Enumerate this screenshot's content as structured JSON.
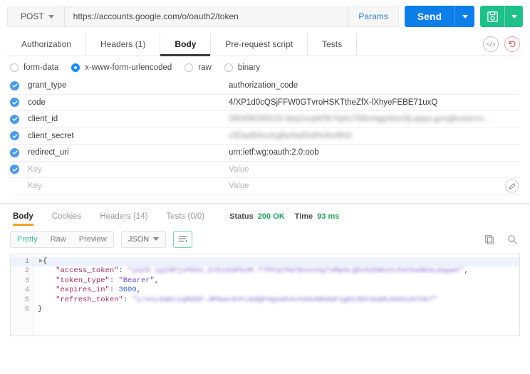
{
  "request": {
    "method": "POST",
    "url": "https://accounts.google.com/o/oauth2/token",
    "params_label": "Params",
    "send_label": "Send",
    "save_icon": "floppy-disk-icon",
    "code_icon": "code-brackets-icon",
    "reset_icon": "undo-reset-icon",
    "tabs": [
      {
        "label": "Authorization",
        "active": false
      },
      {
        "label": "Headers (1)",
        "active": false
      },
      {
        "label": "Body",
        "active": true
      },
      {
        "label": "Pre-request script",
        "active": false
      },
      {
        "label": "Tests",
        "active": false
      }
    ],
    "body_types": [
      {
        "label": "form-data",
        "checked": false
      },
      {
        "label": "x-www-form-urlencoded",
        "checked": true
      },
      {
        "label": "raw",
        "checked": false
      },
      {
        "label": "binary",
        "checked": false
      }
    ],
    "kv_placeholders": {
      "key": "Key",
      "value": "Value"
    },
    "kv_rows": [
      {
        "checked": true,
        "key": "grant_type",
        "value": "authorization_code",
        "blurred": false
      },
      {
        "checked": true,
        "key": "code",
        "value": "4/XP1d0cQSjFFW0GTvroHSKTtheZfX-lXhyeFEBE71uxQ",
        "blurred": false
      },
      {
        "checked": true,
        "key": "client_id",
        "value": "390486349115-bkq2uvpkf3b7iq4u7t5kmiqgnben5lj.apps.googleusercontent.com",
        "blurred": true
      },
      {
        "checked": true,
        "key": "client_secret",
        "value": "v3Dad94cuXgBw5wfGdHv8m8N3",
        "blurred": true
      },
      {
        "checked": true,
        "key": "redirect_uri",
        "value": "urn:ietf:wg:oauth:2.0:oob",
        "blurred": false
      },
      {
        "checked": true,
        "key": "Key",
        "value": "Value",
        "blurred": false,
        "placeholder": true
      },
      {
        "checked": false,
        "key": "Key",
        "value": "Value",
        "blurred": false,
        "placeholder": true
      }
    ],
    "bulk_edit_icon": "pencil-edit-icon"
  },
  "response": {
    "tabs": [
      {
        "label": "Body",
        "active": true
      },
      {
        "label": "Cookies",
        "active": false
      },
      {
        "label": "Headers (14)",
        "active": false
      },
      {
        "label": "Tests (0/0)",
        "active": false
      }
    ],
    "status_label": "Status",
    "status_value": "200 OK",
    "time_label": "Time",
    "time_value": "93 ms",
    "view_modes": [
      {
        "label": "Pretty",
        "active": true
      },
      {
        "label": "Raw",
        "active": false
      },
      {
        "label": "Preview",
        "active": false
      }
    ],
    "format_selected": "JSON",
    "wrap_icon": "wrap-lines-icon",
    "copy_icon": "copy-icon",
    "search_icon": "search-icon",
    "body_lines": [
      {
        "n": "1",
        "foldable": true,
        "highlight": true,
        "tokens": [
          {
            "t": "{",
            "c": "pun"
          }
        ]
      },
      {
        "n": "2",
        "foldable": false,
        "highlight": false,
        "tokens": [
          {
            "t": "    \"access_token\"",
            "c": "key"
          },
          {
            "t": ": ",
            "c": "pun"
          },
          {
            "t": "\"ya29.igIHPjsP89z_bYbi93PkeM.T7PFqtPm7BsXvVg7oMpOLQ6vhZDNuVLPeChaNKALDqqah\"",
            "c": "blur"
          },
          {
            "t": ",",
            "c": "pun"
          }
        ]
      },
      {
        "n": "3",
        "foldable": false,
        "highlight": false,
        "tokens": [
          {
            "t": "    \"token_type\"",
            "c": "key"
          },
          {
            "t": ": ",
            "c": "pun"
          },
          {
            "t": "\"Bearer\"",
            "c": "str"
          },
          {
            "t": ",",
            "c": "pun"
          }
        ]
      },
      {
        "n": "4",
        "foldable": false,
        "highlight": false,
        "tokens": [
          {
            "t": "    \"expires_in\"",
            "c": "key"
          },
          {
            "t": ": ",
            "c": "pun"
          },
          {
            "t": "3600",
            "c": "num"
          },
          {
            "t": ",",
            "c": "pun"
          }
        ]
      },
      {
        "n": "5",
        "foldable": false,
        "highlight": false,
        "tokens": [
          {
            "t": "    \"refresh_token\"",
            "c": "key"
          },
          {
            "t": ": ",
            "c": "pun"
          },
          {
            "t": "\"1/esL6aEciqRGSF-dPkwv3nFLGdQFAgvwh4vtm3vNbdaF1gDz3DtdumkzK6XiATCKT\"",
            "c": "blur"
          }
        ]
      },
      {
        "n": "6",
        "foldable": false,
        "highlight": false,
        "tokens": [
          {
            "t": "}",
            "c": "pun"
          }
        ]
      }
    ]
  }
}
